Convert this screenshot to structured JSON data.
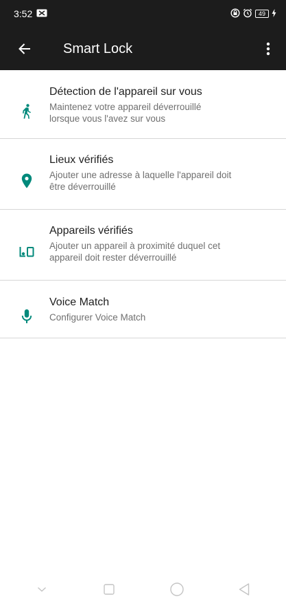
{
  "status_bar": {
    "time": "3:52",
    "battery": "49"
  },
  "app_bar": {
    "title": "Smart Lock"
  },
  "colors": {
    "accent": "#00897b",
    "app_bar": "#1c1c1c"
  },
  "items": [
    {
      "icon": "walking-person-icon",
      "title": "Détection de l'appareil sur vous",
      "subtitle_line1": "Maintenez votre appareil déverrouillé",
      "subtitle_line2": "lorsque vous l'avez sur vous"
    },
    {
      "icon": "location-pin-icon",
      "title": "Lieux vérifiés",
      "subtitle_line1": "Ajouter une adresse à laquelle l'appareil doit",
      "subtitle_line2": "être déverrouillé"
    },
    {
      "icon": "devices-icon",
      "title": "Appareils vérifiés",
      "subtitle_line1": "Ajouter un appareil à proximité duquel cet",
      "subtitle_line2": "appareil doit rester déverrouillé"
    },
    {
      "icon": "microphone-icon",
      "title": "Voice Match",
      "subtitle_line1": "Configurer Voice Match"
    }
  ],
  "nav_bar": {
    "buttons": [
      "chevron-down-icon",
      "recents-square-icon",
      "home-circle-icon",
      "back-triangle-icon"
    ]
  }
}
